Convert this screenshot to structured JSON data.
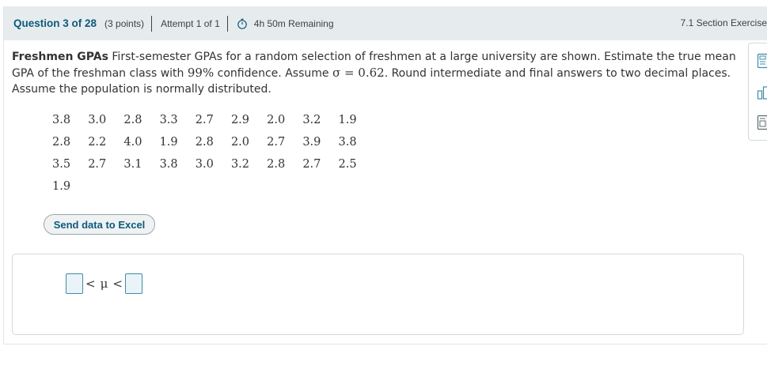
{
  "header": {
    "question_label": "Question 3 of 28",
    "points_label": "(3 points)",
    "attempt_label": "Attempt 1 of 1",
    "timer_icon": "stopwatch-icon",
    "time_remaining": "4h 50m Remaining",
    "section_label": "7.1 Section Exercise"
  },
  "problem": {
    "title": "Freshmen GPAs",
    "text_part1": "First-semester GPAs for a random selection of freshmen at a large university are shown. Estimate the true mean GPA of the freshman class with ",
    "confidence": "99%",
    "text_part2": " confidence. Assume ",
    "sigma_expr": "σ = 0.62",
    "text_part3": ". Round intermediate and final answers to two decimal places. Assume the population is normally distributed."
  },
  "data_rows": [
    [
      "3.8",
      "3.0",
      "2.8",
      "3.3",
      "2.7",
      "2.9",
      "2.0",
      "3.2",
      "1.9"
    ],
    [
      "2.8",
      "2.2",
      "4.0",
      "1.9",
      "2.8",
      "2.0",
      "2.7",
      "3.9",
      "3.8"
    ],
    [
      "3.5",
      "2.7",
      "3.1",
      "3.8",
      "3.0",
      "3.2",
      "2.8",
      "2.7",
      "2.5"
    ],
    [
      "1.9"
    ]
  ],
  "excel_button_label": "Send data to Excel",
  "answer": {
    "lower_value": "",
    "inequality_left": "<",
    "mu_symbol": "μ",
    "inequality_right": "<",
    "upper_value": ""
  },
  "side_tools": [
    "calculator-icon",
    "split-view-icon",
    "reference-icon"
  ],
  "colors": {
    "header_bg": "#e6ecee",
    "accent": "#0f5a7c",
    "input_border": "#3d8da6"
  }
}
